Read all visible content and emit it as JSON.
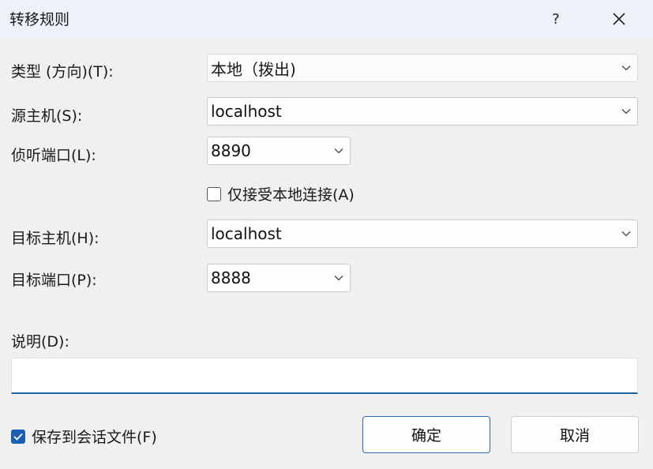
{
  "dialog": {
    "title": "转移规则",
    "help_glyph": "?",
    "close_icon": "close-icon"
  },
  "form": {
    "type_label": "类型 (方向)(T):",
    "type_value": "本地（拨出)",
    "source_host_label": "源主机(S):",
    "source_host_value": "localhost",
    "listen_port_label": "侦听端口(L):",
    "listen_port_value": "8890",
    "local_only_label": "仅接受本地连接(A)",
    "local_only_checked": false,
    "target_host_label": "目标主机(H):",
    "target_host_value": "localhost",
    "target_port_label": "目标端口(P):",
    "target_port_value": "8888",
    "description_label": "说明(D):",
    "description_value": ""
  },
  "footer": {
    "save_to_session_label": "保存到会话文件(F)",
    "save_to_session_checked": true,
    "ok_label": "确定",
    "cancel_label": "取消"
  },
  "colors": {
    "accent": "#1a5fb4",
    "background": "#f0f0f0",
    "titlebar": "#eef2f8"
  }
}
